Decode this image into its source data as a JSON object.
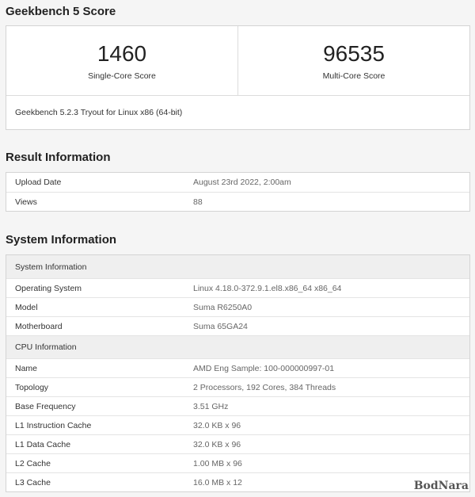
{
  "score_section": {
    "title": "Geekbench 5 Score",
    "single_core": {
      "value": "1460",
      "label": "Single-Core Score"
    },
    "multi_core": {
      "value": "96535",
      "label": "Multi-Core Score"
    },
    "version": "Geekbench 5.2.3 Tryout for Linux x86 (64-bit)"
  },
  "result_section": {
    "title": "Result Information",
    "rows": [
      {
        "key": "Upload Date",
        "value": "August 23rd 2022, 2:00am"
      },
      {
        "key": "Views",
        "value": "88"
      }
    ]
  },
  "system_section": {
    "title": "System Information",
    "group1": {
      "header": "System Information",
      "rows": [
        {
          "key": "Operating System",
          "value": "Linux 4.18.0-372.9.1.el8.x86_64 x86_64"
        },
        {
          "key": "Model",
          "value": "Suma R6250A0"
        },
        {
          "key": "Motherboard",
          "value": "Suma 65GA24"
        }
      ]
    },
    "group2": {
      "header": "CPU Information",
      "rows": [
        {
          "key": "Name",
          "value": "AMD Eng Sample: 100-000000997-01"
        },
        {
          "key": "Topology",
          "value": "2 Processors, 192 Cores, 384 Threads"
        },
        {
          "key": "Base Frequency",
          "value": "3.51 GHz"
        },
        {
          "key": "L1 Instruction Cache",
          "value": "32.0 KB x 96"
        },
        {
          "key": "L1 Data Cache",
          "value": "32.0 KB x 96"
        },
        {
          "key": "L2 Cache",
          "value": "1.00 MB x 96"
        },
        {
          "key": "L3 Cache",
          "value": "16.0 MB x 12"
        }
      ]
    }
  },
  "watermark": "BodNara"
}
